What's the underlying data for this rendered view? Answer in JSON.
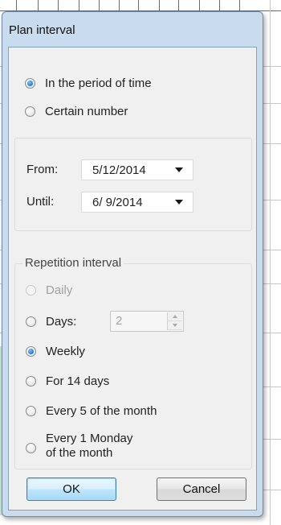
{
  "dialog": {
    "title": "Plan interval"
  },
  "mode": {
    "options": [
      {
        "label": "In the period of time",
        "checked": true
      },
      {
        "label": "Certain number",
        "checked": false
      }
    ]
  },
  "range": {
    "from_label": "From:",
    "from_value": "5/12/2014",
    "until_label": "Until:",
    "until_value": "6/ 9/2014"
  },
  "repetition": {
    "legend": "Repetition interval",
    "options": [
      {
        "label": "Daily",
        "checked": false,
        "disabled": true
      },
      {
        "label": "Days:",
        "checked": false,
        "disabled": false
      },
      {
        "label": "Weekly",
        "checked": true,
        "disabled": false
      },
      {
        "label": "For 14 days",
        "checked": false,
        "disabled": false
      },
      {
        "label": "Every 5 of the month",
        "checked": false,
        "disabled": false
      },
      {
        "label": "Every 1 Monday\nof the month",
        "checked": false,
        "disabled": false
      }
    ],
    "days_value": "2"
  },
  "buttons": {
    "ok_label": "OK",
    "cancel_label": "Cancel"
  },
  "colors": {
    "dialog_frame": "#c9dced",
    "client_bg": "#f0f0f0",
    "radio_checked": "#1a6fc8",
    "default_button": "#3c7fb1"
  },
  "icons": {
    "radio": "radio-icon",
    "dropdown": "chevron-down-icon",
    "spin_up": "spin-up-icon",
    "spin_down": "spin-down-icon"
  }
}
